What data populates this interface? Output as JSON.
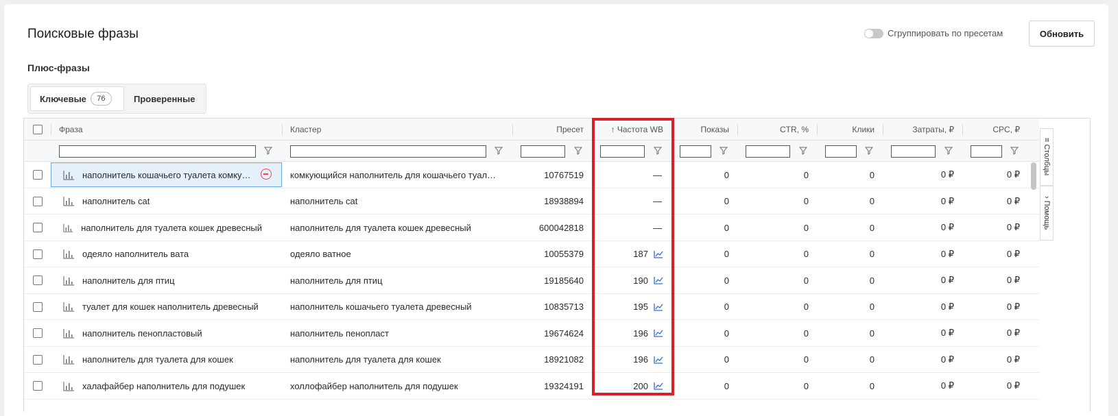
{
  "header": {
    "title": "Поисковые фразы",
    "group_toggle_label": "Сгруппировать по пресетам",
    "refresh_label": "Обновить"
  },
  "section": {
    "subtitle": "Плюс-фразы"
  },
  "tabs": [
    {
      "label": "Ключевые",
      "count": "76"
    },
    {
      "label": "Проверенные"
    }
  ],
  "table": {
    "columns": [
      "Фраза",
      "Кластер",
      "Пресет",
      "↑ Частота WB",
      "Показы",
      "CTR, %",
      "Клики",
      "Затраты, ₽",
      "CPC, ₽"
    ],
    "rows": [
      {
        "phrase": "наполнитель кошачьего туалета комку…",
        "cluster": "комкующийся наполнитель для кошачьего туал…",
        "preset": "10767519",
        "freq": "—",
        "shows": "0",
        "ctr": "0",
        "clicks": "0",
        "cost": "0 ₽",
        "cpc": "0 ₽"
      },
      {
        "phrase": "наполнитель cat",
        "cluster": "наполнитель cat",
        "preset": "18938894",
        "freq": "—",
        "shows": "0",
        "ctr": "0",
        "clicks": "0",
        "cost": "0 ₽",
        "cpc": "0 ₽"
      },
      {
        "phrase": "наполнитель для туалета кошек древесный",
        "cluster": "наполнитель для туалета кошек древесный",
        "preset": "600042818",
        "freq": "—",
        "shows": "0",
        "ctr": "0",
        "clicks": "0",
        "cost": "0 ₽",
        "cpc": "0 ₽"
      },
      {
        "phrase": "одеяло наполнитель вата",
        "cluster": "одеяло ватное",
        "preset": "10055379",
        "freq": "187",
        "shows": "0",
        "ctr": "0",
        "clicks": "0",
        "cost": "0 ₽",
        "cpc": "0 ₽"
      },
      {
        "phrase": "наполнитель для птиц",
        "cluster": "наполнитель для птиц",
        "preset": "19185640",
        "freq": "190",
        "shows": "0",
        "ctr": "0",
        "clicks": "0",
        "cost": "0 ₽",
        "cpc": "0 ₽"
      },
      {
        "phrase": "туалет для кошек наполнитель древесный",
        "cluster": "наполнитель кошачьего туалета древесный",
        "preset": "10835713",
        "freq": "195",
        "shows": "0",
        "ctr": "0",
        "clicks": "0",
        "cost": "0 ₽",
        "cpc": "0 ₽"
      },
      {
        "phrase": "наполнитель пенопластовый",
        "cluster": "наполнитель пенопласт",
        "preset": "19674624",
        "freq": "196",
        "shows": "0",
        "ctr": "0",
        "clicks": "0",
        "cost": "0 ₽",
        "cpc": "0 ₽"
      },
      {
        "phrase": "наполнитель для туалета для кошек",
        "cluster": "наполнитель для туалета для кошек",
        "preset": "18921082",
        "freq": "196",
        "shows": "0",
        "ctr": "0",
        "clicks": "0",
        "cost": "0 ₽",
        "cpc": "0 ₽"
      },
      {
        "phrase": "халафайбер наполнитель для подушек",
        "cluster": "холлофайбер наполнитель для подушек",
        "preset": "19324191",
        "freq": "200",
        "shows": "0",
        "ctr": "0",
        "clicks": "0",
        "cost": "0 ₽",
        "cpc": "0 ₽"
      }
    ]
  },
  "side_panel": {
    "columns_label": "Столбцы",
    "help_label": "Помощь"
  },
  "colors": {
    "accent_blue": "#2f6fd6",
    "highlight_red": "#d6202a",
    "remove_red": "#e14b4b"
  },
  "icons": [
    "filter-icon",
    "bar-chart-icon",
    "trend-chart-icon",
    "remove-circle-icon",
    "columns-icon",
    "chevron-icon"
  ]
}
